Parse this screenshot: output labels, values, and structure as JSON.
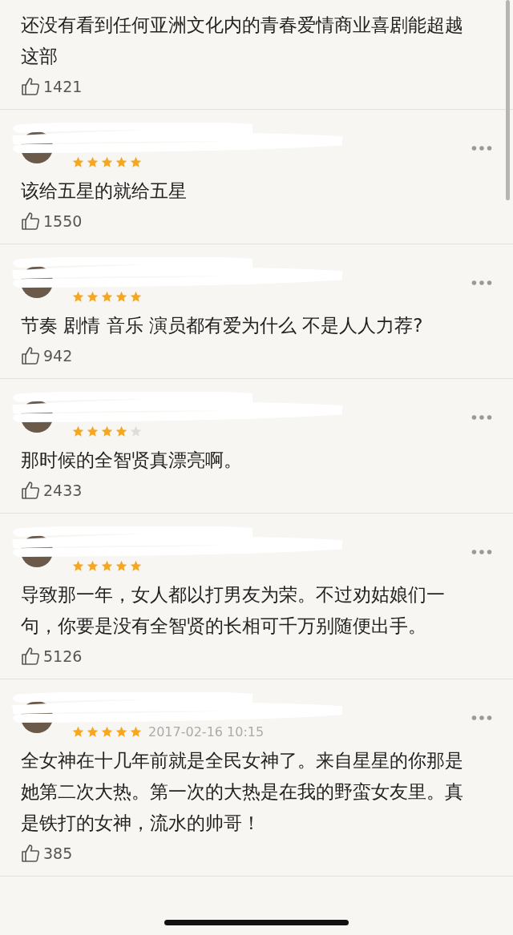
{
  "comments": [
    {
      "text": "还没有看到任何亚洲文化内的青春爱情商业喜剧能超越这部",
      "likes": "1421"
    },
    {
      "stars": 5,
      "text": "该给五星的就给五星",
      "likes": "1550"
    },
    {
      "stars": 5,
      "text": "节奏 剧情 音乐 演员都有爱为什么 不是人人力荐?",
      "likes": "942"
    },
    {
      "stars": 4,
      "text": "那时候的全智贤真漂亮啊。",
      "likes": "2433"
    },
    {
      "stars": 5,
      "text": "导致那一年，女人都以打男友为荣。不过劝姑娘们一句，你要是没有全智贤的长相可千万别随便出手。",
      "likes": "5126"
    },
    {
      "stars": 5,
      "date": "2017-02-16 10:15",
      "text": "全女神在十几年前就是全民女神了。来自星星的你那是她第二次大热。第一次的大热是在我的野蛮女友里。真是铁打的女神，流水的帅哥！",
      "likes": "385"
    }
  ]
}
